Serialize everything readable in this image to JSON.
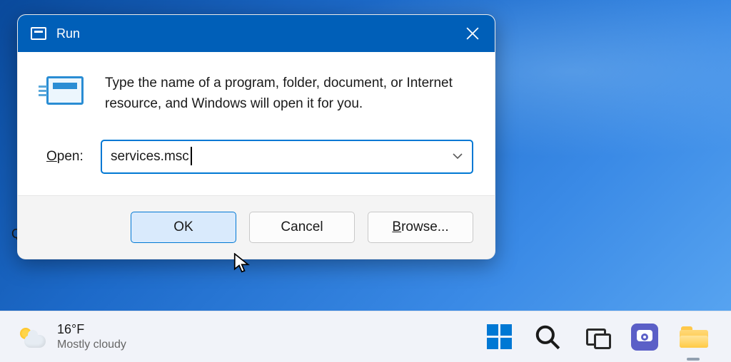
{
  "dialog": {
    "title": "Run",
    "description": "Type the name of a program, folder, document, or Internet resource, and Windows will open it for you.",
    "open_label_pre": "O",
    "open_label_post": "pen:",
    "input_value": "services.msc",
    "buttons": {
      "ok": "OK",
      "cancel": "Cancel",
      "browse_pre": "B",
      "browse_post": "rowse..."
    }
  },
  "taskbar": {
    "weather": {
      "temp": "16°F",
      "condition": "Mostly cloudy"
    }
  },
  "misc": {
    "hidden_q": "Q"
  }
}
